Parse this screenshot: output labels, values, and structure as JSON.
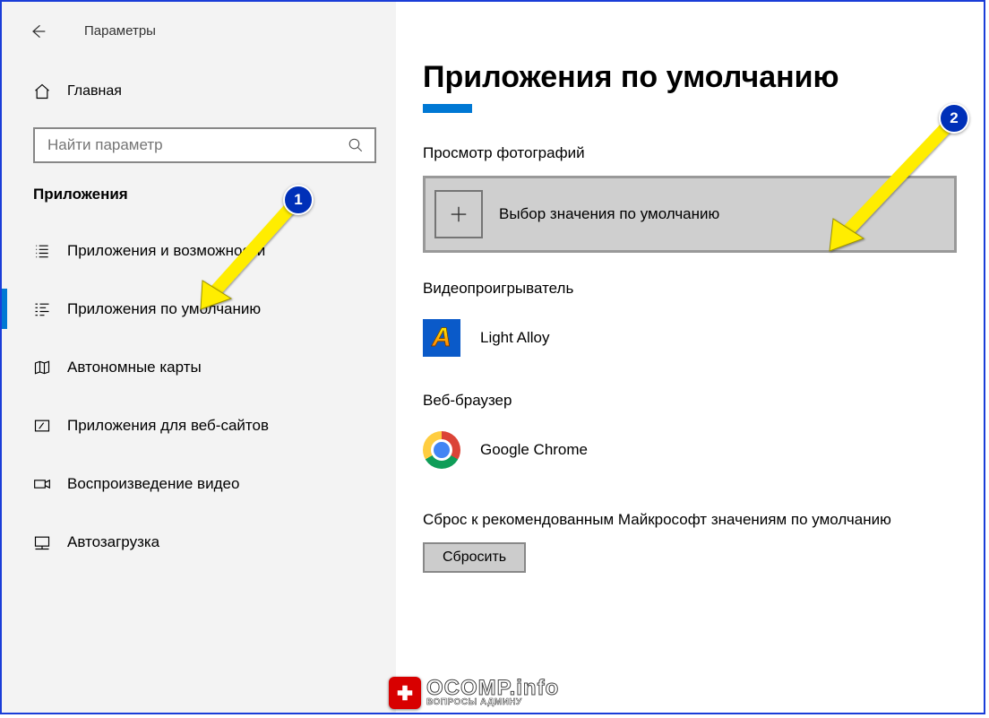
{
  "window": {
    "title": "Параметры"
  },
  "sidebar": {
    "home": "Главная",
    "search_placeholder": "Найти параметр",
    "section": "Приложения",
    "items": [
      {
        "label": "Приложения и возможности"
      },
      {
        "label": "Приложения по умолчанию"
      },
      {
        "label": "Автономные карты"
      },
      {
        "label": "Приложения для веб-сайтов"
      },
      {
        "label": "Воспроизведение видео"
      },
      {
        "label": "Автозагрузка"
      }
    ]
  },
  "main": {
    "title": "Приложения по умолчанию",
    "groups": {
      "photo": {
        "label": "Просмотр фотографий",
        "choice": "Выбор значения по умолчанию"
      },
      "video": {
        "label": "Видеопроигрыватель",
        "app": "Light Alloy"
      },
      "browser": {
        "label": "Веб-браузер",
        "app": "Google Chrome"
      }
    },
    "reset_text": "Сброс к рекомендованным Майкрософт значениям по умолчанию",
    "reset_btn": "Сбросить"
  },
  "callouts": {
    "one": "1",
    "two": "2"
  },
  "watermark": {
    "main": "OCOMP.info",
    "sub": "ВОПРОСЫ АДМИНУ"
  }
}
